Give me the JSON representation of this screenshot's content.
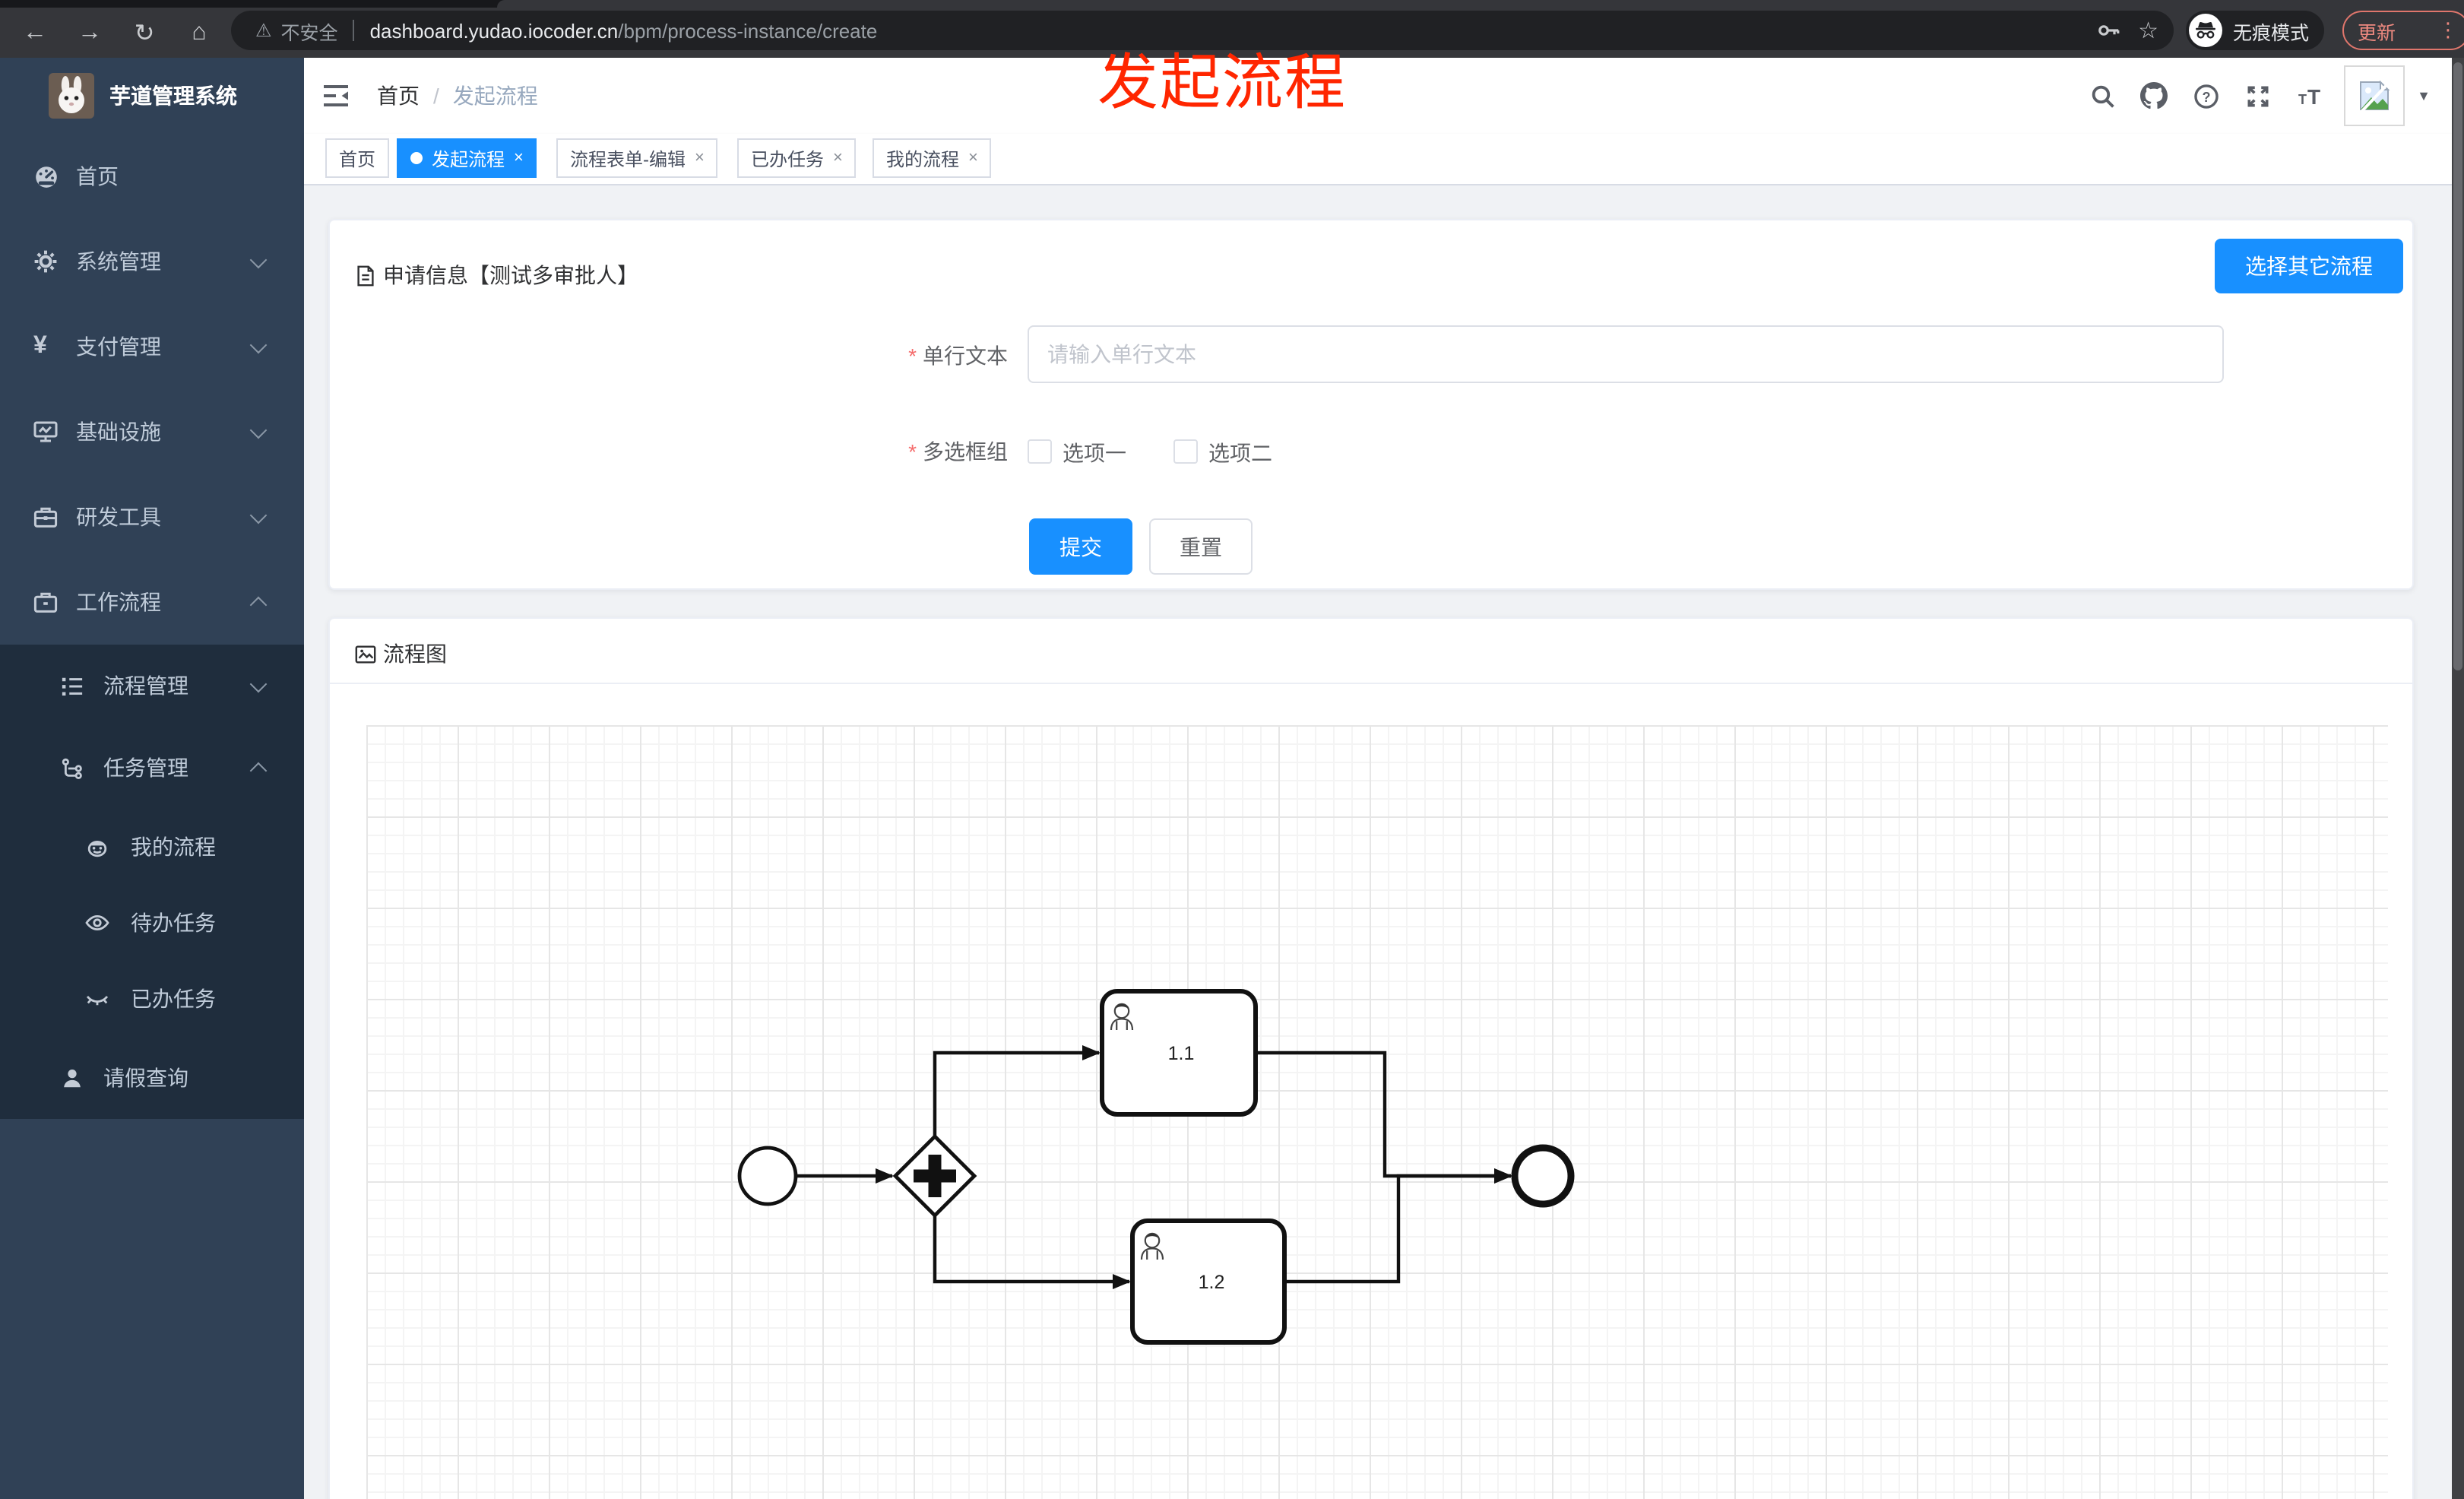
{
  "browser": {
    "security_label": "不安全",
    "url_domain": "dashboard.yudao.iocoder.cn",
    "url_path": "/bpm/process-instance/create",
    "incognito_label": "无痕模式",
    "update_label": "更新"
  },
  "icons": {
    "back": "←",
    "forward": "→",
    "reload": "↻",
    "home": "⌂",
    "warning": "⚠",
    "star": "☆",
    "more_vert": "⋮",
    "dropdown_caret": "▼",
    "yen": "¥",
    "question": "?",
    "font_large": "T",
    "font_small": "T",
    "close": "×"
  },
  "annotation": {
    "text": "发起流程",
    "color": "#ff2600"
  },
  "sidebar": {
    "app_title": "芋道管理系统",
    "items": [
      {
        "label": "首页",
        "icon": "dashboard-icon",
        "level": 1
      },
      {
        "label": "系统管理",
        "icon": "gear-icon",
        "level": 1,
        "chevron": "down"
      },
      {
        "label": "支付管理",
        "icon": "yen-icon",
        "level": 1,
        "chevron": "down"
      },
      {
        "label": "基础设施",
        "icon": "monitor-icon",
        "level": 1,
        "chevron": "down"
      },
      {
        "label": "研发工具",
        "icon": "toolbox-icon",
        "level": 1,
        "chevron": "down"
      },
      {
        "label": "工作流程",
        "icon": "briefcase-icon",
        "level": 1,
        "chevron": "up"
      },
      {
        "label": "流程管理",
        "icon": "flow-list-icon",
        "level": 2,
        "chevron": "down"
      },
      {
        "label": "任务管理",
        "icon": "task-tree-icon",
        "level": 2,
        "chevron": "up"
      },
      {
        "label": "我的流程",
        "icon": "robot-icon",
        "level": 3
      },
      {
        "label": "待办任务",
        "icon": "eye-icon",
        "level": 3
      },
      {
        "label": "已办任务",
        "icon": "eye-closed-icon",
        "level": 3
      },
      {
        "label": "请假查询",
        "icon": "user-icon",
        "level": 2
      }
    ]
  },
  "breadcrumb": {
    "home": "首页",
    "separator": "/",
    "current": "发起流程"
  },
  "tabs": [
    {
      "label": "首页",
      "active": false,
      "closable": false
    },
    {
      "label": "发起流程",
      "active": true,
      "closable": true
    },
    {
      "label": "流程表单-编辑",
      "active": false,
      "closable": true
    },
    {
      "label": "已办任务",
      "active": false,
      "closable": true
    },
    {
      "label": "我的流程",
      "active": false,
      "closable": true
    }
  ],
  "form_card": {
    "title": "申请信息【测试多审批人】",
    "select_other_label": "选择其它流程",
    "required_mark": "*",
    "text_field": {
      "label": "单行文本",
      "required": true,
      "placeholder": "请输入单行文本",
      "value": ""
    },
    "checkbox_group": {
      "label": "多选框组",
      "required": true,
      "options": [
        {
          "label": "选项一",
          "checked": false
        },
        {
          "label": "选项二",
          "checked": false
        }
      ]
    },
    "submit_label": "提交",
    "reset_label": "重置"
  },
  "diagram_card": {
    "title": "流程图",
    "process": {
      "nodes": [
        {
          "id": "start",
          "type": "start-event"
        },
        {
          "id": "gateway",
          "type": "parallel-gateway"
        },
        {
          "id": "task1",
          "type": "user-task",
          "label": "1.1"
        },
        {
          "id": "task2",
          "type": "user-task",
          "label": "1.2"
        },
        {
          "id": "end",
          "type": "end-event"
        }
      ],
      "flows": [
        "start→gateway",
        "gateway→task1",
        "gateway→task2",
        "task1→end",
        "task2→end"
      ]
    },
    "task_labels": {
      "t1": "1.1",
      "t2": "1.2"
    }
  },
  "colors": {
    "accent": "#1890ff",
    "sidebar_bg": "#304156",
    "sidebar_submenu_bg": "#1f2d3d",
    "sidebar_text": "#bfcbd9",
    "content_bg": "#f0f2f5",
    "annotation_red": "#ff2600",
    "chrome_bg": "#35363a",
    "omnibox_bg": "#202124",
    "update_red": "#ef8a80"
  }
}
